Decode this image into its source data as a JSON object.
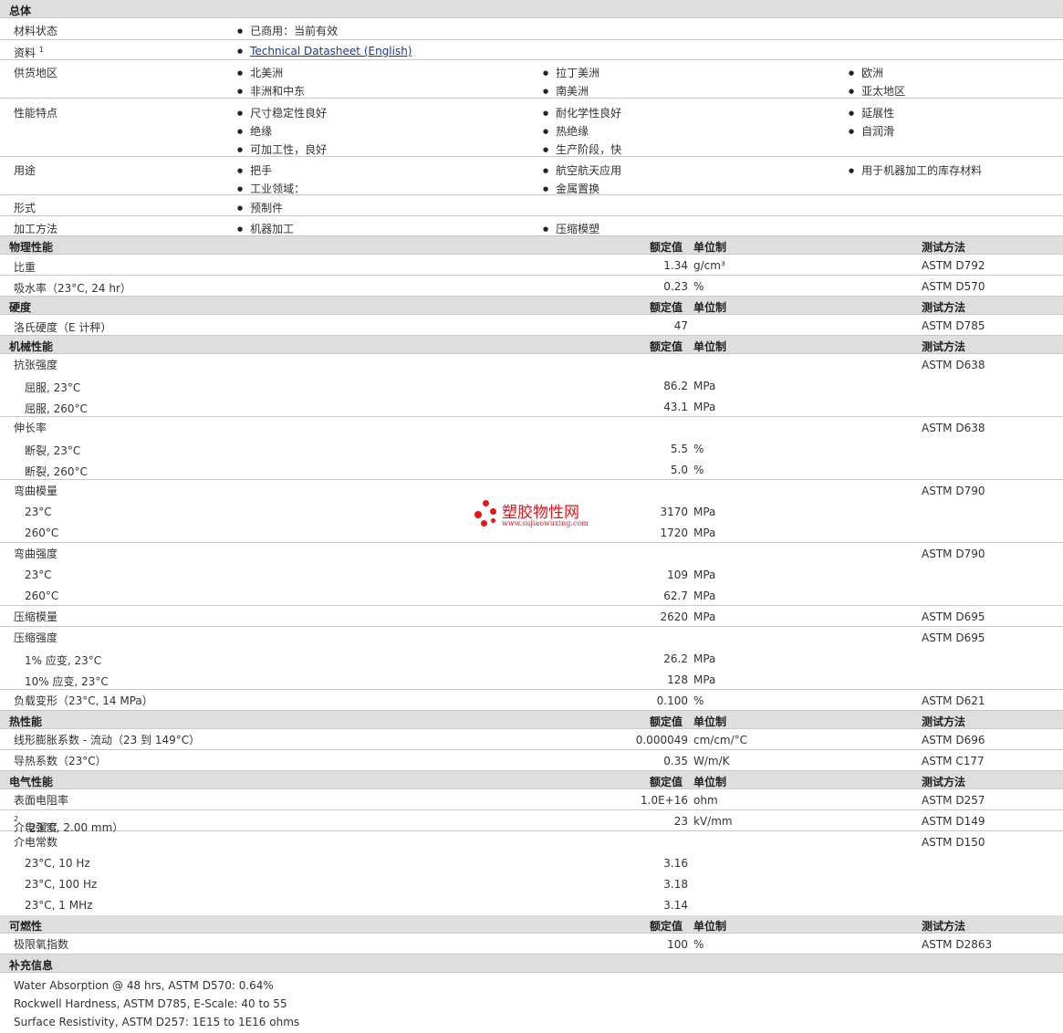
{
  "general": {
    "title": "总体",
    "status_label": "材料状态",
    "status": "已商用：当前有效",
    "docs_label": "资料",
    "docs_sup": "1",
    "doc_link": "Technical Datasheet (English)",
    "regions_label": "供货地区",
    "regions": [
      "北美洲",
      "拉丁美洲",
      "欧洲",
      "非洲和中东",
      "南美洲",
      "亚太地区"
    ],
    "features_label": "性能特点",
    "features": [
      "尺寸稳定性良好",
      "耐化学性良好",
      "延展性",
      "绝缘",
      "热绝缘",
      "自润滑",
      "可加工性，良好",
      "生产阶段，快"
    ],
    "uses_label": "用途",
    "uses": [
      "把手",
      "航空航天应用",
      "用于机器加工的库存材料",
      "工业领域：",
      "金属置换"
    ],
    "form_label": "形式",
    "form": "预制件",
    "process_label": "加工方法",
    "process": [
      "机器加工",
      "压缩模塑"
    ]
  },
  "hdr": {
    "nominal": "额定值",
    "unit": "单位制",
    "method": "测试方法"
  },
  "physical": {
    "title": "物理性能",
    "rows": [
      {
        "label": "比重",
        "value": "1.34",
        "unit": "g/cm³",
        "method": "ASTM D792"
      },
      {
        "label": "吸水率（23°C, 24 hr）",
        "value": "0.23",
        "unit": "%",
        "method": "ASTM D570"
      }
    ]
  },
  "hardness": {
    "title": "硬度",
    "rows": [
      {
        "label": "洛氏硬度（E 计秤）",
        "value": "47",
        "unit": "",
        "method": "ASTM D785"
      }
    ]
  },
  "mechanical": {
    "title": "机械性能",
    "tensile": "抗张强度",
    "tensile_method": "ASTM D638",
    "t1": "屈服, 23°C",
    "t1v": "86.2",
    "t2": "屈服, 260°C",
    "t2v": "43.1",
    "elong": "伸长率",
    "elong_method": "ASTM D638",
    "e1": "断裂, 23°C",
    "e1v": "5.5",
    "e2": "断裂, 260°C",
    "e2v": "5.0",
    "flexmod": "弯曲模量",
    "flexmod_method": "ASTM D790",
    "fm1": "23°C",
    "fm1v": "3170",
    "fm2": "260°C",
    "fm2v": "1720",
    "flexstr": "弯曲强度",
    "flexstr_method": "ASTM D790",
    "fs1": "23°C",
    "fs1v": "109",
    "fs2": "260°C",
    "fs2v": "62.7",
    "compmod": "压缩模量",
    "compmod_v": "2620",
    "compmod_method": "ASTM D695",
    "compstr": "压缩强度",
    "compstr_method": "ASTM D695",
    "cs1": "1% 应变, 23°C",
    "cs1v": "26.2",
    "cs2": "10% 应变, 23°C",
    "cs2v": "128",
    "deform": "负载变形（23°C, 14 MPa）",
    "deform_v": "0.100",
    "deform_method": "ASTM D621",
    "mpa": "MPa",
    "pct": "%"
  },
  "thermal": {
    "title": "热性能",
    "rows": [
      {
        "label": "线形膨胀系数 - 流动（23 到  149°C）",
        "value": "0.000049",
        "unit": "cm/cm/°C",
        "method": "ASTM D696"
      },
      {
        "label": "导热系数（23°C）",
        "value": "0.35",
        "unit": "W/m/K",
        "method": "ASTM C177"
      }
    ]
  },
  "electrical": {
    "title": "电气性能",
    "surf": "表面电阻率",
    "surf_v": "1.0E+16",
    "surf_u": "ohm",
    "surf_m": "ASTM D257",
    "diel": "介电强度",
    "diel_sup": "2",
    "diel_tail": "（23°C, 2.00 mm）",
    "diel_v": "23",
    "diel_u": "kV/mm",
    "diel_m": "ASTM D149",
    "dconst": "介电常数",
    "dconst_m": "ASTM D150",
    "dc1": "23°C, 10 Hz",
    "dc1v": "3.16",
    "dc2": "23°C, 100 Hz",
    "dc2v": "3.18",
    "dc3": "23°C, 1 MHz",
    "dc3v": "3.14"
  },
  "flammability": {
    "title": "可燃性",
    "loi": "极限氧指数",
    "loi_v": "100",
    "loi_u": "%",
    "loi_m": "ASTM D2863"
  },
  "additional": {
    "title": "补充信息",
    "notes": [
      "Water Absorption @ 48 hrs, ASTM D570: 0.64%",
      "Rockwell Hardness, ASTM D785, E-Scale: 40 to 55",
      "Surface Resistivity, ASTM D257: 1E15 to 1E16 ohms"
    ]
  },
  "watermark": {
    "name": "塑胶物性网",
    "url": "www.sujiaowuxing.com"
  }
}
